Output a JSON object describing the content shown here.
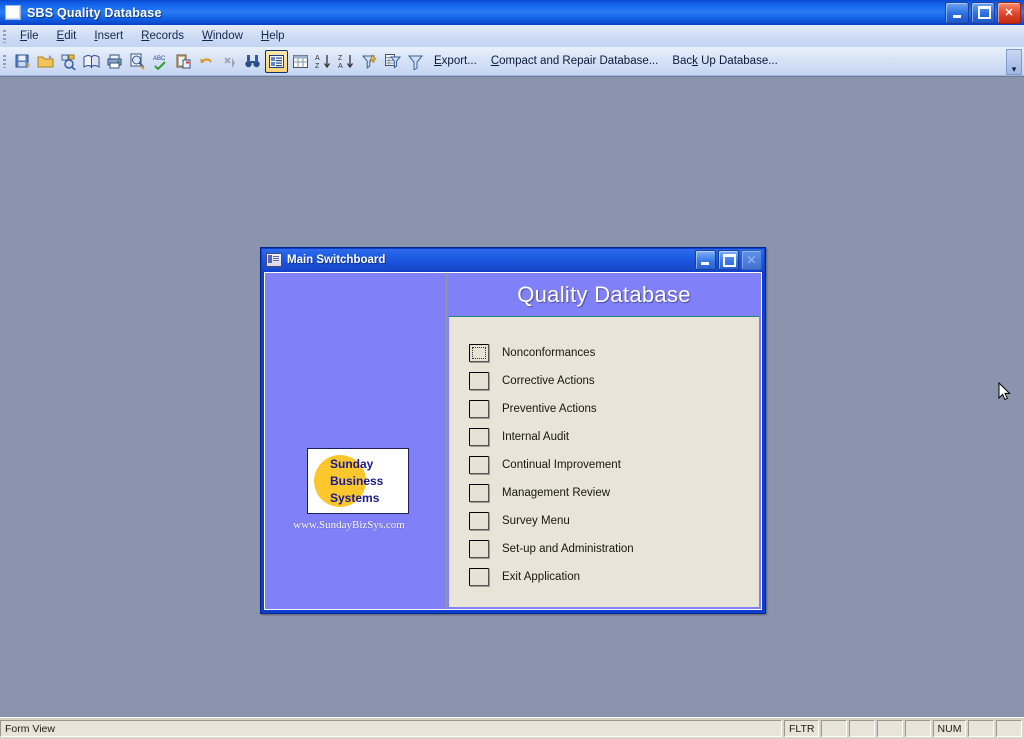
{
  "window": {
    "title": "SBS Quality Database",
    "icon": "database-window-icon",
    "controls": {
      "minimize": "Minimize",
      "restore": "Restore",
      "close": "Close"
    }
  },
  "menubar": {
    "items": [
      {
        "label": "File",
        "accel": "F"
      },
      {
        "label": "Edit",
        "accel": "E"
      },
      {
        "label": "Insert",
        "accel": "I"
      },
      {
        "label": "Records",
        "accel": "R"
      },
      {
        "label": "Window",
        "accel": "W"
      },
      {
        "label": "Help",
        "accel": "H"
      }
    ]
  },
  "toolbar": {
    "icon_buttons": [
      "save-icon",
      "open-folder-icon",
      "relationships-icon",
      "book-icon",
      "print-icon",
      "print-preview-icon",
      "spelling-icon",
      "paste-icon",
      "undo-icon",
      "redo-icon",
      "find-binoculars-icon"
    ],
    "selected_icon_button": "properties-icon",
    "icon_buttons_after": [
      "datasheet-view-icon",
      "sort-ascending-icon",
      "sort-descending-icon",
      "filter-by-selection-icon",
      "filter-by-form-icon",
      "apply-filter-icon"
    ],
    "text_buttons": [
      {
        "label": "Export...",
        "accel": "E"
      },
      {
        "label": "Compact and Repair Database...",
        "accel": "C"
      },
      {
        "label": "Back Up Database...",
        "accel": "k"
      }
    ],
    "overflow_label": "Toolbar Options"
  },
  "switchboard": {
    "title": "Main Switchboard",
    "icon": "form-window-icon",
    "controls": {
      "minimize": "Minimize",
      "maximize": "Maximize",
      "close": "Close"
    },
    "header": "Quality Database",
    "logo": {
      "line1": "Sunday",
      "line2": "Business",
      "line3": "Systems",
      "url": "www.SundayBizSys.com",
      "circle_color": "#fbc72c",
      "text_color": "#1a1a8c"
    },
    "panel_color": "#8080f8",
    "list_color": "#e8e5d8",
    "items": [
      {
        "label": "Nonconformances",
        "focused": true
      },
      {
        "label": "Corrective Actions",
        "focused": false
      },
      {
        "label": "Preventive Actions",
        "focused": false
      },
      {
        "label": "Internal Audit",
        "focused": false
      },
      {
        "label": "Continual Improvement",
        "focused": false
      },
      {
        "label": "Management Review",
        "focused": false
      },
      {
        "label": "Survey Menu",
        "focused": false
      },
      {
        "label": "Set-up and Administration",
        "focused": false
      },
      {
        "label": "Exit Application",
        "focused": false
      }
    ]
  },
  "statusbar": {
    "view": "Form View",
    "filter": "FLTR",
    "numlock": "NUM"
  }
}
